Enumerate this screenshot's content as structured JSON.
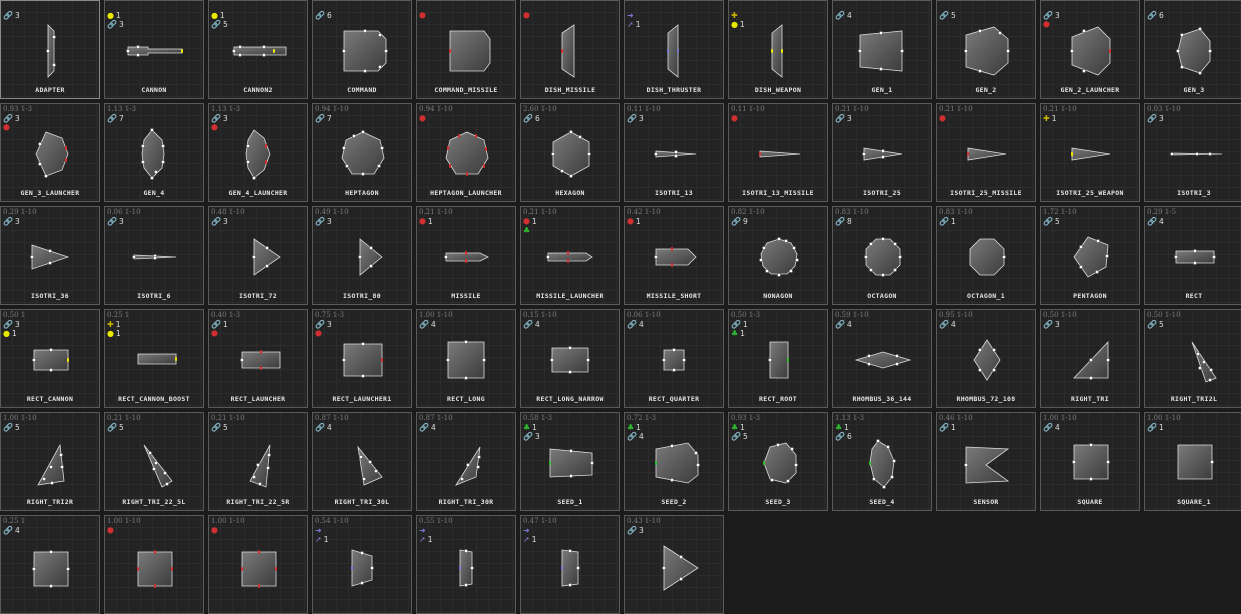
{
  "colors": {
    "background": "#1b1b1b",
    "tile_border": "#5a5a5a",
    "shape_fill": "#6a6a6a",
    "shape_stroke": "#dcdcdc",
    "port_normal": "#f2f2f2",
    "port_cannon": "#e8e800",
    "port_launcher": "#d23030",
    "port_thruster": "#7a7ad6",
    "port_root": "#2ec02e"
  },
  "icons": {
    "link": "link-icon",
    "cannon": "cannon-port-icon",
    "launcher": "launcher-port-icon",
    "thruster": "thruster-port-icon",
    "weapon": "weapon-port-icon",
    "boost": "boost-port-icon",
    "root": "root-port-icon"
  },
  "tiles": [
    {
      "name": "ADAPTER",
      "stats": "",
      "ports": [
        {
          "icon": "link",
          "glyph": "🔗",
          "color": "#c8c8c8",
          "count": "3"
        }
      ],
      "shape": "adapter"
    },
    {
      "name": "CANNON",
      "stats": "",
      "ports": [
        {
          "icon": "cannon",
          "glyph": "●",
          "color": "#e8e800",
          "count": "1"
        },
        {
          "icon": "link",
          "glyph": "🔗",
          "color": "#c8c8c8",
          "count": "3"
        }
      ],
      "shape": "cannon"
    },
    {
      "name": "CANNON2",
      "stats": "",
      "ports": [
        {
          "icon": "cannon",
          "glyph": "●",
          "color": "#e8e800",
          "count": "1"
        },
        {
          "icon": "link",
          "glyph": "🔗",
          "color": "#c8c8c8",
          "count": "5"
        }
      ],
      "shape": "cannon2"
    },
    {
      "name": "COMMAND",
      "stats": "",
      "ports": [
        {
          "icon": "link",
          "glyph": "🔗",
          "color": "#c8c8c8",
          "count": "6"
        }
      ],
      "shape": "command"
    },
    {
      "name": "COMMAND_MISSILE",
      "stats": "",
      "ports": [
        {
          "icon": "launcher",
          "glyph": "⬢",
          "color": "#d23030",
          "count": ""
        }
      ],
      "shape": "command_missile"
    },
    {
      "name": "DISH_MISSILE",
      "stats": "",
      "ports": [
        {
          "icon": "launcher",
          "glyph": "⬢",
          "color": "#d23030",
          "count": ""
        }
      ],
      "shape": "dish"
    },
    {
      "name": "DISH_THRUSTER",
      "stats": "",
      "ports": [
        {
          "icon": "thruster",
          "glyph": "➜",
          "color": "#7a7ad6",
          "count": ""
        },
        {
          "icon": "thruster",
          "glyph": "➚",
          "color": "#7a7ad6",
          "count": "1"
        }
      ],
      "shape": "dish_thruster"
    },
    {
      "name": "DISH_WEAPON",
      "stats": "",
      "ports": [
        {
          "icon": "boost",
          "glyph": "✚",
          "color": "#c8b400",
          "count": ""
        },
        {
          "icon": "cannon",
          "glyph": "●",
          "color": "#e8e800",
          "count": "1"
        }
      ],
      "shape": "dish_weapon"
    },
    {
      "name": "GEN_1",
      "stats": "",
      "ports": [
        {
          "icon": "link",
          "glyph": "🔗",
          "color": "#c8c8c8",
          "count": "4"
        }
      ],
      "shape": "gen_1"
    },
    {
      "name": "GEN_2",
      "stats": "",
      "ports": [
        {
          "icon": "link",
          "glyph": "🔗",
          "color": "#c8c8c8",
          "count": "5"
        }
      ],
      "shape": "gen_2"
    },
    {
      "name": "GEN_2_LAUNCHER",
      "stats": "",
      "ports": [
        {
          "icon": "link",
          "glyph": "🔗",
          "color": "#c8c8c8",
          "count": "3"
        },
        {
          "icon": "launcher",
          "glyph": "⬢",
          "color": "#d23030",
          "count": ""
        }
      ],
      "shape": "gen_2_launcher"
    },
    {
      "name": "GEN_3",
      "stats": "",
      "ports": [
        {
          "icon": "link",
          "glyph": "🔗",
          "color": "#c8c8c8",
          "count": "6"
        }
      ],
      "shape": "gen_3"
    },
    {
      "name": "GEN_3_LAUNCHER",
      "stats": "0.93 1-3",
      "ports": [
        {
          "icon": "link",
          "glyph": "🔗",
          "color": "#c8c8c8",
          "count": "3"
        },
        {
          "icon": "launcher",
          "glyph": "⬢",
          "color": "#d23030",
          "count": ""
        }
      ],
      "shape": "gen_3_launcher"
    },
    {
      "name": "GEN_4",
      "stats": "1.13 1-3",
      "ports": [
        {
          "icon": "link",
          "glyph": "🔗",
          "color": "#c8c8c8",
          "count": "7"
        }
      ],
      "shape": "gen_4"
    },
    {
      "name": "GEN_4_LAUNCHER",
      "stats": "1.13 1-3",
      "ports": [
        {
          "icon": "link",
          "glyph": "🔗",
          "color": "#c8c8c8",
          "count": "3"
        },
        {
          "icon": "launcher",
          "glyph": "⬢",
          "color": "#d23030",
          "count": ""
        }
      ],
      "shape": "gen_4_launcher"
    },
    {
      "name": "HEPTAGON",
      "stats": "0.94 1-10",
      "ports": [
        {
          "icon": "link",
          "glyph": "🔗",
          "color": "#c8c8c8",
          "count": "7"
        }
      ],
      "shape": "heptagon"
    },
    {
      "name": "HEPTAGON_LAUNCHER",
      "stats": "0.94 1-10",
      "ports": [
        {
          "icon": "launcher",
          "glyph": "⬢",
          "color": "#d23030",
          "count": ""
        }
      ],
      "shape": "heptagon_launcher"
    },
    {
      "name": "HEXAGON",
      "stats": "2.60 1-10",
      "ports": [
        {
          "icon": "link",
          "glyph": "🔗",
          "color": "#c8c8c8",
          "count": "6"
        }
      ],
      "shape": "hexagon"
    },
    {
      "name": "ISOTRI_13",
      "stats": "0.11 1-10",
      "ports": [
        {
          "icon": "link",
          "glyph": "🔗",
          "color": "#c8c8c8",
          "count": "3"
        }
      ],
      "shape": "isotri_13"
    },
    {
      "name": "ISOTRI_13_MISSILE",
      "stats": "0.11 1-10",
      "ports": [
        {
          "icon": "launcher",
          "glyph": "⬢",
          "color": "#d23030",
          "count": ""
        }
      ],
      "shape": "isotri_13_missile"
    },
    {
      "name": "ISOTRI_25",
      "stats": "0.21 1-10",
      "ports": [
        {
          "icon": "link",
          "glyph": "🔗",
          "color": "#c8c8c8",
          "count": "3"
        }
      ],
      "shape": "isotri_25"
    },
    {
      "name": "ISOTRI_25_MISSILE",
      "stats": "0.21 1-10",
      "ports": [
        {
          "icon": "launcher",
          "glyph": "⬢",
          "color": "#d23030",
          "count": ""
        }
      ],
      "shape": "isotri_25_missile"
    },
    {
      "name": "ISOTRI_25_WEAPON",
      "stats": "0.21 1-10",
      "ports": [
        {
          "icon": "boost",
          "glyph": "✚",
          "color": "#c8b400",
          "count": "1"
        }
      ],
      "shape": "isotri_25_weapon"
    },
    {
      "name": "ISOTRI_3",
      "stats": "0.03 1-10",
      "ports": [
        {
          "icon": "link",
          "glyph": "🔗",
          "color": "#c8c8c8",
          "count": "3"
        }
      ],
      "shape": "isotri_3"
    },
    {
      "name": "ISOTRI_36",
      "stats": "0.29 1-10",
      "ports": [
        {
          "icon": "link",
          "glyph": "🔗",
          "color": "#c8c8c8",
          "count": "3"
        }
      ],
      "shape": "isotri_36"
    },
    {
      "name": "ISOTRI_6",
      "stats": "0.06 1-10",
      "ports": [
        {
          "icon": "link",
          "glyph": "🔗",
          "color": "#c8c8c8",
          "count": "3"
        }
      ],
      "shape": "isotri_6"
    },
    {
      "name": "ISOTRI_72",
      "stats": "0.48 1-10",
      "ports": [
        {
          "icon": "link",
          "glyph": "🔗",
          "color": "#c8c8c8",
          "count": "3"
        }
      ],
      "shape": "isotri_72"
    },
    {
      "name": "ISOTRI_80",
      "stats": "0.49 1-10",
      "ports": [
        {
          "icon": "link",
          "glyph": "🔗",
          "color": "#c8c8c8",
          "count": "3"
        }
      ],
      "shape": "isotri_80"
    },
    {
      "name": "MISSILE",
      "stats": "0.21 1-10",
      "ports": [
        {
          "icon": "launcher",
          "glyph": "⬢",
          "color": "#d23030",
          "count": "1"
        }
      ],
      "shape": "missile"
    },
    {
      "name": "MISSILE_LAUNCHER",
      "stats": "0.21 1-10",
      "ports": [
        {
          "icon": "launcher",
          "glyph": "⬢",
          "color": "#d23030",
          "count": "1"
        },
        {
          "icon": "root",
          "glyph": "♣",
          "color": "#2ec02e",
          "count": ""
        }
      ],
      "shape": "missile_launcher"
    },
    {
      "name": "MISSILE_SHORT",
      "stats": "0.42 1-10",
      "ports": [
        {
          "icon": "launcher",
          "glyph": "⬢",
          "color": "#d23030",
          "count": "1"
        }
      ],
      "shape": "missile_short"
    },
    {
      "name": "NONAGON",
      "stats": "0.82 1-10",
      "ports": [
        {
          "icon": "link",
          "glyph": "🔗",
          "color": "#c8c8c8",
          "count": "9"
        }
      ],
      "shape": "nonagon"
    },
    {
      "name": "OCTAGON",
      "stats": "0.83 1-10",
      "ports": [
        {
          "icon": "link",
          "glyph": "🔗",
          "color": "#c8c8c8",
          "count": "8"
        }
      ],
      "shape": "octagon"
    },
    {
      "name": "OCTAGON_1",
      "stats": "0.83 1-10",
      "ports": [
        {
          "icon": "link",
          "glyph": "🔗",
          "color": "#c8c8c8",
          "count": "1"
        }
      ],
      "shape": "octagon_1"
    },
    {
      "name": "PENTAGON",
      "stats": "1.72 1-10",
      "ports": [
        {
          "icon": "link",
          "glyph": "🔗",
          "color": "#c8c8c8",
          "count": "5"
        }
      ],
      "shape": "pentagon"
    },
    {
      "name": "RECT",
      "stats": "0.29 1-5",
      "ports": [
        {
          "icon": "link",
          "glyph": "🔗",
          "color": "#c8c8c8",
          "count": "4"
        }
      ],
      "shape": "rect"
    },
    {
      "name": "RECT_CANNON",
      "stats": "0.50 1",
      "ports": [
        {
          "icon": "link",
          "glyph": "🔗",
          "color": "#c8c8c8",
          "count": "3"
        },
        {
          "icon": "cannon",
          "glyph": "●",
          "color": "#e8e800",
          "count": "1"
        }
      ],
      "shape": "rect_cannon"
    },
    {
      "name": "RECT_CANNON_BOOST",
      "stats": "0.25 1",
      "ports": [
        {
          "icon": "boost",
          "glyph": "✚",
          "color": "#c8b400",
          "count": "1"
        },
        {
          "icon": "cannon",
          "glyph": "●",
          "color": "#e8e800",
          "count": "1"
        }
      ],
      "shape": "rect_cannon_boost"
    },
    {
      "name": "RECT_LAUNCHER",
      "stats": "0.40 1-3",
      "ports": [
        {
          "icon": "link",
          "glyph": "🔗",
          "color": "#c8c8c8",
          "count": "1"
        },
        {
          "icon": "launcher",
          "glyph": "⬢",
          "color": "#d23030",
          "count": ""
        }
      ],
      "shape": "rect_launcher"
    },
    {
      "name": "RECT_LAUNCHER1",
      "stats": "0.75 1-3",
      "ports": [
        {
          "icon": "link",
          "glyph": "🔗",
          "color": "#c8c8c8",
          "count": "3"
        },
        {
          "icon": "launcher",
          "glyph": "⬢",
          "color": "#d23030",
          "count": ""
        }
      ],
      "shape": "rect_launcher1"
    },
    {
      "name": "RECT_LONG",
      "stats": "1.00 1-10",
      "ports": [
        {
          "icon": "link",
          "glyph": "🔗",
          "color": "#c8c8c8",
          "count": "4"
        }
      ],
      "shape": "rect_long"
    },
    {
      "name": "RECT_LONG_NARROW",
      "stats": "0.15 1-10",
      "ports": [
        {
          "icon": "link",
          "glyph": "🔗",
          "color": "#c8c8c8",
          "count": "4"
        }
      ],
      "shape": "rect_long_narrow"
    },
    {
      "name": "RECT_QUARTER",
      "stats": "0.06 1-10",
      "ports": [
        {
          "icon": "link",
          "glyph": "🔗",
          "color": "#c8c8c8",
          "count": "4"
        }
      ],
      "shape": "rect_quarter"
    },
    {
      "name": "RECT_ROOT",
      "stats": "0.50 1-3",
      "ports": [
        {
          "icon": "link",
          "glyph": "🔗",
          "color": "#c8c8c8",
          "count": "1"
        },
        {
          "icon": "root",
          "glyph": "♣",
          "color": "#2ec02e",
          "count": "1"
        }
      ],
      "shape": "rect_root"
    },
    {
      "name": "RHOMBUS_36_144",
      "stats": "0.59 1-10",
      "ports": [
        {
          "icon": "link",
          "glyph": "🔗",
          "color": "#c8c8c8",
          "count": "4"
        }
      ],
      "shape": "rhombus_36"
    },
    {
      "name": "RHOMBUS_72_108",
      "stats": "0.95 1-10",
      "ports": [
        {
          "icon": "link",
          "glyph": "🔗",
          "color": "#c8c8c8",
          "count": "4"
        }
      ],
      "shape": "rhombus_72"
    },
    {
      "name": "RIGHT_TRI",
      "stats": "0.50 1-10",
      "ports": [
        {
          "icon": "link",
          "glyph": "🔗",
          "color": "#c8c8c8",
          "count": "3"
        }
      ],
      "shape": "right_tri"
    },
    {
      "name": "RIGHT_TRI2L",
      "stats": "0.50 1-10",
      "ports": [
        {
          "icon": "link",
          "glyph": "🔗",
          "color": "#c8c8c8",
          "count": "5"
        }
      ],
      "shape": "right_tri2l"
    },
    {
      "name": "RIGHT_TRI2R",
      "stats": "1.00 1-10",
      "ports": [
        {
          "icon": "link",
          "glyph": "🔗",
          "color": "#c8c8c8",
          "count": "5"
        }
      ],
      "shape": "right_tri2r"
    },
    {
      "name": "RIGHT_TRI_22_5L",
      "stats": "0.21 1-10",
      "ports": [
        {
          "icon": "link",
          "glyph": "🔗",
          "color": "#c8c8c8",
          "count": "5"
        }
      ],
      "shape": "right_tri_22l"
    },
    {
      "name": "RIGHT_TRI_22_5R",
      "stats": "0.21 1-10",
      "ports": [
        {
          "icon": "link",
          "glyph": "🔗",
          "color": "#c8c8c8",
          "count": "5"
        }
      ],
      "shape": "right_tri_22r"
    },
    {
      "name": "RIGHT_TRI_30L",
      "stats": "0.87 1-10",
      "ports": [
        {
          "icon": "link",
          "glyph": "🔗",
          "color": "#c8c8c8",
          "count": "4"
        }
      ],
      "shape": "right_tri_30l"
    },
    {
      "name": "RIGHT_TRI_30R",
      "stats": "0.87 1-10",
      "ports": [
        {
          "icon": "link",
          "glyph": "🔗",
          "color": "#c8c8c8",
          "count": "4"
        }
      ],
      "shape": "right_tri_30r"
    },
    {
      "name": "SEED_1",
      "stats": "0.58 1-3",
      "ports": [
        {
          "icon": "root",
          "glyph": "♣",
          "color": "#2ec02e",
          "count": "1"
        },
        {
          "icon": "link",
          "glyph": "🔗",
          "color": "#c8c8c8",
          "count": "3"
        }
      ],
      "shape": "seed_1"
    },
    {
      "name": "SEED_2",
      "stats": "0.72 1-3",
      "ports": [
        {
          "icon": "root",
          "glyph": "♣",
          "color": "#2ec02e",
          "count": "1"
        },
        {
          "icon": "link",
          "glyph": "🔗",
          "color": "#c8c8c8",
          "count": "4"
        }
      ],
      "shape": "seed_2"
    },
    {
      "name": "SEED_3",
      "stats": "0.93 1-3",
      "ports": [
        {
          "icon": "root",
          "glyph": "♣",
          "color": "#2ec02e",
          "count": "1"
        },
        {
          "icon": "link",
          "glyph": "🔗",
          "color": "#c8c8c8",
          "count": "5"
        }
      ],
      "shape": "seed_3"
    },
    {
      "name": "SEED_4",
      "stats": "1.13 1-3",
      "ports": [
        {
          "icon": "root",
          "glyph": "♣",
          "color": "#2ec02e",
          "count": "1"
        },
        {
          "icon": "link",
          "glyph": "🔗",
          "color": "#c8c8c8",
          "count": "6"
        }
      ],
      "shape": "seed_4"
    },
    {
      "name": "SENSOR",
      "stats": "0.46 1-10",
      "ports": [
        {
          "icon": "link",
          "glyph": "🔗",
          "color": "#c8c8c8",
          "count": "1"
        }
      ],
      "shape": "sensor"
    },
    {
      "name": "SQUARE",
      "stats": "1.00 1-10",
      "ports": [
        {
          "icon": "link",
          "glyph": "🔗",
          "color": "#c8c8c8",
          "count": "4"
        }
      ],
      "shape": "square"
    },
    {
      "name": "SQUARE_1",
      "stats": "1.00 1-10",
      "ports": [
        {
          "icon": "link",
          "glyph": "🔗",
          "color": "#c8c8c8",
          "count": "1"
        }
      ],
      "shape": "square_1"
    },
    {
      "name": "",
      "stats": "0.25 1",
      "ports": [
        {
          "icon": "link",
          "glyph": "🔗",
          "color": "#c8c8c8",
          "count": "4"
        }
      ],
      "shape": "sq_a"
    },
    {
      "name": "",
      "stats": "1.00 1-10",
      "ports": [
        {
          "icon": "launcher",
          "glyph": "⬢",
          "color": "#d23030",
          "count": ""
        }
      ],
      "shape": "sq_b"
    },
    {
      "name": "",
      "stats": "1.00 1-10",
      "ports": [
        {
          "icon": "launcher",
          "glyph": "⬢",
          "color": "#d23030",
          "count": ""
        }
      ],
      "shape": "sq_c"
    },
    {
      "name": "",
      "stats": "0.54 1-10",
      "ports": [
        {
          "icon": "thruster",
          "glyph": "➜",
          "color": "#7a7ad6",
          "count": ""
        },
        {
          "icon": "thruster",
          "glyph": "➚",
          "color": "#7a7ad6",
          "count": "1"
        }
      ],
      "shape": "trap_a"
    },
    {
      "name": "",
      "stats": "0.55 1-10",
      "ports": [
        {
          "icon": "thruster",
          "glyph": "➜",
          "color": "#7a7ad6",
          "count": ""
        },
        {
          "icon": "thruster",
          "glyph": "➚",
          "color": "#7a7ad6",
          "count": "1"
        }
      ],
      "shape": "trap_b"
    },
    {
      "name": "",
      "stats": "0.47 1-10",
      "ports": [
        {
          "icon": "thruster",
          "glyph": "➜",
          "color": "#7a7ad6",
          "count": ""
        },
        {
          "icon": "thruster",
          "glyph": "➚",
          "color": "#7a7ad6",
          "count": "1"
        }
      ],
      "shape": "trap_c"
    },
    {
      "name": "",
      "stats": "0.43 1-10",
      "ports": [
        {
          "icon": "link",
          "glyph": "🔗",
          "color": "#c8c8c8",
          "count": "3"
        }
      ],
      "shape": "tri_d"
    }
  ]
}
